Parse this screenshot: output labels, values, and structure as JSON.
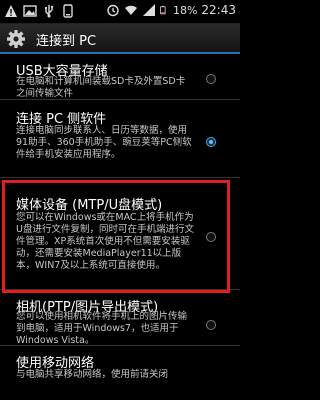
{
  "status_bar": {
    "icons": [
      "warning-icon",
      "image-icon",
      "usb-icon",
      "phone-icon",
      "alarm-icon",
      "wifi-icon",
      "signal-icon",
      "battery-icon"
    ],
    "battery": "18%",
    "time": "22:43"
  },
  "title_bar": {
    "icon": "gear-icon",
    "title": "连接到 PC"
  },
  "options": [
    {
      "title": "USB大容量存储",
      "summary": "在电脑和计算机间装载SD卡及外置SD卡之间传输文件",
      "selected": false
    },
    {
      "title": "连接 PC 侧软件",
      "summary": "连接电脑同步联系人、日历等数据，使用91助手、360手机助手、豌豆荚等PC侧软件给手机安装应用程序。",
      "selected": true
    },
    {
      "title": "媒体设备 (MTP/U盘模式)",
      "summary": "您可以在Windows或在MAC上将手机作为U盘进行文件复制，同时可在手机端进行文件管理。XP系统首次使用不但需要安装驱动，还需要安装MediaPlayer11以上版本，WIN7及以上系统可直接使用。",
      "selected": false
    },
    {
      "title": "相机(PTP/图片导出模式)",
      "summary": "您可以使用相机软件将手机上的图片传输到电脑，适用于Windows7，也适用于Windows Vista。",
      "selected": false
    },
    {
      "title": "使用移动网络",
      "summary": "与电脑共享移动网络，使用前请关闭",
      "selected": false
    }
  ]
}
